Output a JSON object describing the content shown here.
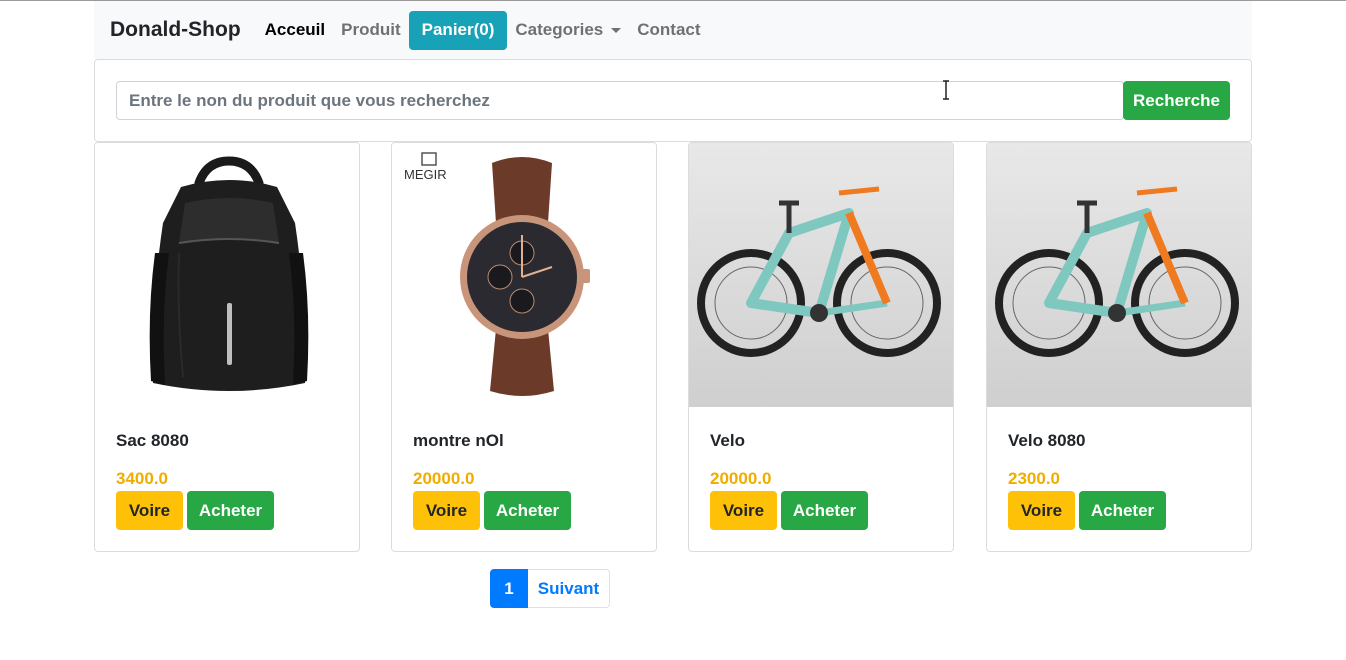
{
  "navbar": {
    "brand": "Donald-Shop",
    "links": [
      {
        "label": "Acceuil"
      },
      {
        "label": "Produit"
      },
      {
        "label": "Panier(0)"
      },
      {
        "label": "Categories"
      },
      {
        "label": "Contact"
      }
    ]
  },
  "search": {
    "placeholder": "Entre le non du produit que vous recherchez",
    "button_label": "Recherche"
  },
  "products": [
    {
      "name": "Sac 8080",
      "price": "3400.0",
      "image_icon": "backpack-icon",
      "view_label": "Voire",
      "buy_label": "Acheter"
    },
    {
      "name": "montre nOl",
      "price": "20000.0",
      "image_icon": "watch-icon",
      "image_logo_text": "MEGIR",
      "view_label": "Voire",
      "buy_label": "Acheter"
    },
    {
      "name": "Velo",
      "price": "20000.0",
      "image_icon": "bicycle-icon",
      "view_label": "Voire",
      "buy_label": "Acheter"
    },
    {
      "name": "Velo 8080",
      "price": "2300.0",
      "image_icon": "bicycle-icon",
      "view_label": "Voire",
      "buy_label": "Acheter"
    }
  ],
  "pagination": {
    "current": "1",
    "next_label": "Suivant"
  },
  "colors": {
    "cart": "#17a2b8",
    "success": "#28a745",
    "warning": "#ffc107",
    "price": "#f0ad00",
    "primary": "#007bff"
  }
}
